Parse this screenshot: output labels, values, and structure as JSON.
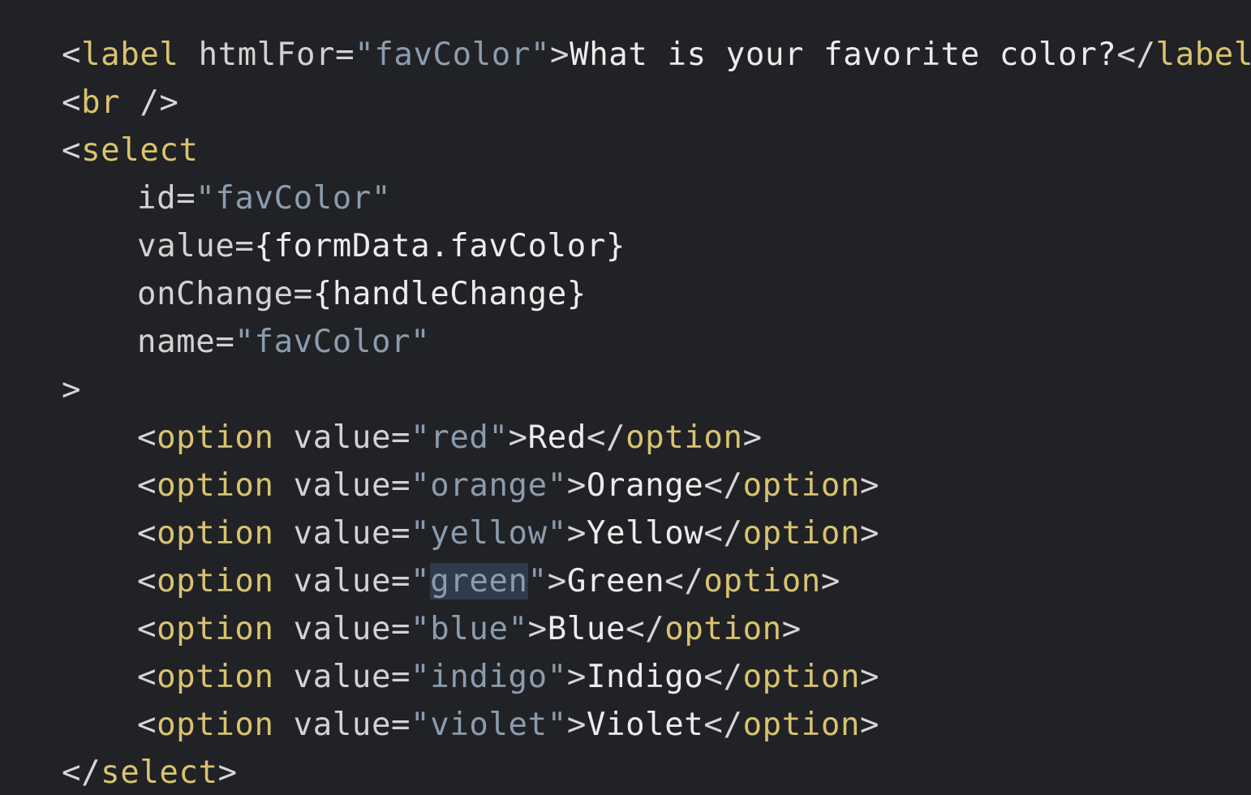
{
  "code": {
    "label_line": {
      "open_bracket": "<",
      "tag": "label",
      "attr": " htmlFor=",
      "value": "\"favColor\"",
      "close_bracket": ">",
      "text": "What is your favorite color?",
      "end_open": "</",
      "end_tag": "label",
      "end_close": ">"
    },
    "br_line": {
      "open_bracket": "<",
      "tag": "br",
      "close": " />"
    },
    "select_open": {
      "open_bracket": "<",
      "tag": "select"
    },
    "select_attrs": [
      {
        "name": "id=",
        "value": "\"favColor\""
      },
      {
        "name": "value=",
        "value": "{formData.favColor}"
      },
      {
        "name": "onChange=",
        "value": "{handleChange}"
      },
      {
        "name": "name=",
        "value": "\"favColor\""
      }
    ],
    "select_close_bracket": ">",
    "option_tag": "option",
    "option_attr": " value=",
    "options": [
      {
        "value": "red",
        "label": "Red"
      },
      {
        "value": "orange",
        "label": "Orange"
      },
      {
        "value": "yellow",
        "label": "Yellow"
      },
      {
        "value": "green",
        "label": "Green"
      },
      {
        "value": "blue",
        "label": "Blue"
      },
      {
        "value": "indigo",
        "label": "Indigo"
      },
      {
        "value": "violet",
        "label": "Violet"
      }
    ],
    "select_end": {
      "open": "</",
      "tag": "select",
      "close": ">"
    }
  }
}
